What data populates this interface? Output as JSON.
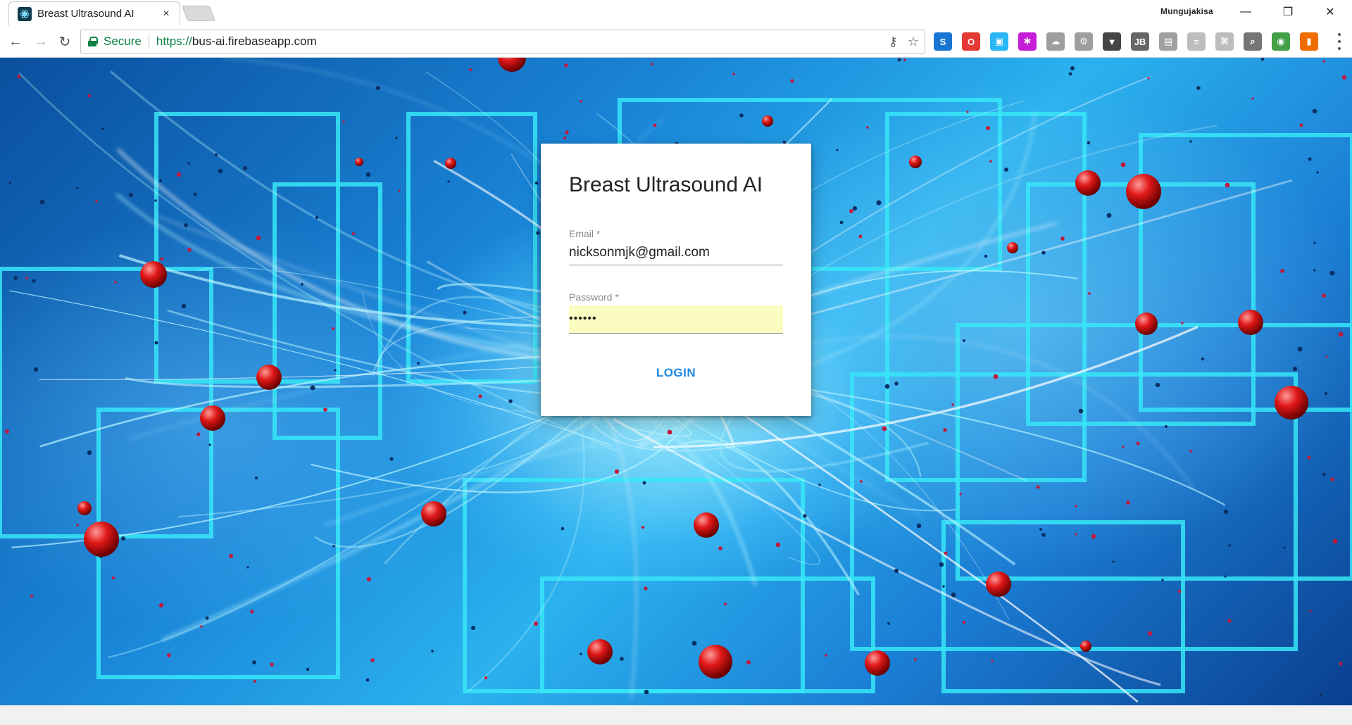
{
  "browser": {
    "tab": {
      "title": "Breast Ultrasound AI",
      "close_glyph": "×",
      "favicon": "ai-app-icon"
    },
    "profile_name": "Mungujakisa",
    "window_controls": {
      "minimize": "—",
      "restore": "❐",
      "close": "✕"
    },
    "nav": {
      "back": "←",
      "forward": "→",
      "reload": "↻"
    },
    "omnibox": {
      "secure_label": "Secure",
      "url_scheme": "https://",
      "url_host": "bus-ai.firebaseapp.com",
      "key_icon": "⚷",
      "star_icon": "☆"
    },
    "extensions": [
      {
        "name": "skype-extension-icon",
        "glyph": "S",
        "color": "#1976d2"
      },
      {
        "name": "opera-extension-icon",
        "glyph": "O",
        "color": "#e53935"
      },
      {
        "name": "window-extension-icon",
        "glyph": "▣",
        "color": "#29b6f6"
      },
      {
        "name": "puzzle-extension-icon",
        "glyph": "✱",
        "color": "#c51ed6"
      },
      {
        "name": "cloud-extension-icon",
        "glyph": "☁",
        "color": "#9e9e9e"
      },
      {
        "name": "gear-badge-extension-icon",
        "glyph": "⚙",
        "color": "#9e9e9e"
      },
      {
        "name": "pocket-extension-icon",
        "glyph": "▼",
        "color": "#444444"
      },
      {
        "name": "jb-extension-icon",
        "glyph": "JB",
        "color": "#666666"
      },
      {
        "name": "document-extension-icon",
        "glyph": "▤",
        "color": "#a0a0a0"
      },
      {
        "name": "list-extension-icon",
        "glyph": "≡",
        "color": "#bdbdbd"
      },
      {
        "name": "pdf-extension-icon",
        "glyph": "⌘",
        "color": "#bdbdbd"
      },
      {
        "name": "search-extension-icon",
        "glyph": "⌕",
        "color": "#757575"
      },
      {
        "name": "chrome-extension-icon",
        "glyph": "◉",
        "color": "#43a047"
      },
      {
        "name": "office-extension-icon",
        "glyph": "▮",
        "color": "#ef6c00"
      }
    ]
  },
  "login": {
    "title": "Breast Ultrasound AI",
    "email_label": "Email *",
    "email_value": "nicksonmjk@gmail.com",
    "password_label": "Password *",
    "password_value": "••••••",
    "login_button": "LOGIN"
  }
}
